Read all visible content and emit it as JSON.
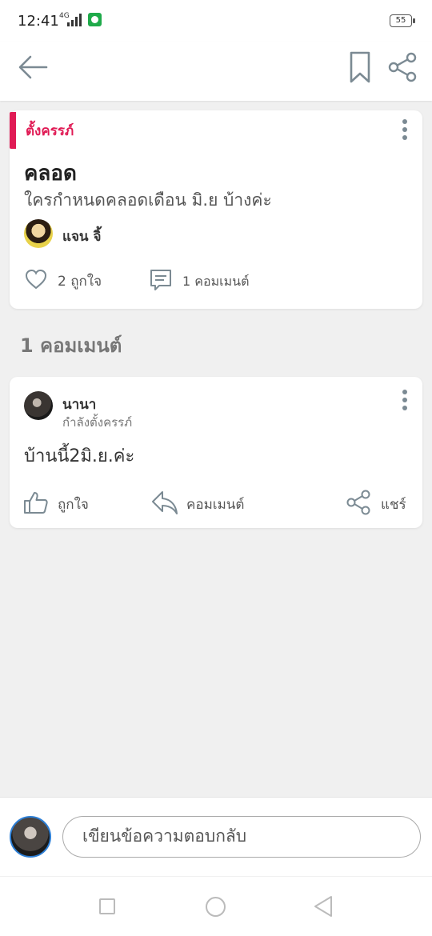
{
  "status_bar": {
    "time": "12:41",
    "network": "4G",
    "battery": "55"
  },
  "post": {
    "tag": "ตั้งครรภ์",
    "title": "คลอด",
    "body": "ใครกำหนดคลอดเดือน มิ.ย บ้างค่ะ",
    "author": "แจน จิ้",
    "likes_label": "2 ถูกใจ",
    "comments_label": "1 คอมเมนต์"
  },
  "comments_heading": "1 คอมเมนต์",
  "comment": {
    "author": "นานา",
    "status": "กำลังตั้งครรภ์",
    "body": "บ้านนี้2มิ.ย.ค่ะ",
    "like_label": "ถูกใจ",
    "reply_label": "คอมเมนต์",
    "share_label": "แชร์"
  },
  "reply_box": {
    "placeholder": "เขียนข้อความตอบกลับ"
  },
  "colors": {
    "accent": "#e01b55",
    "icon": "#7b8a93",
    "background": "#f0f0f0"
  },
  "icons": [
    "back-arrow-icon",
    "bookmark-icon",
    "share-icon",
    "more-vert-icon",
    "heart-icon",
    "comment-icon",
    "thumbs-up-icon",
    "reply-icon"
  ]
}
